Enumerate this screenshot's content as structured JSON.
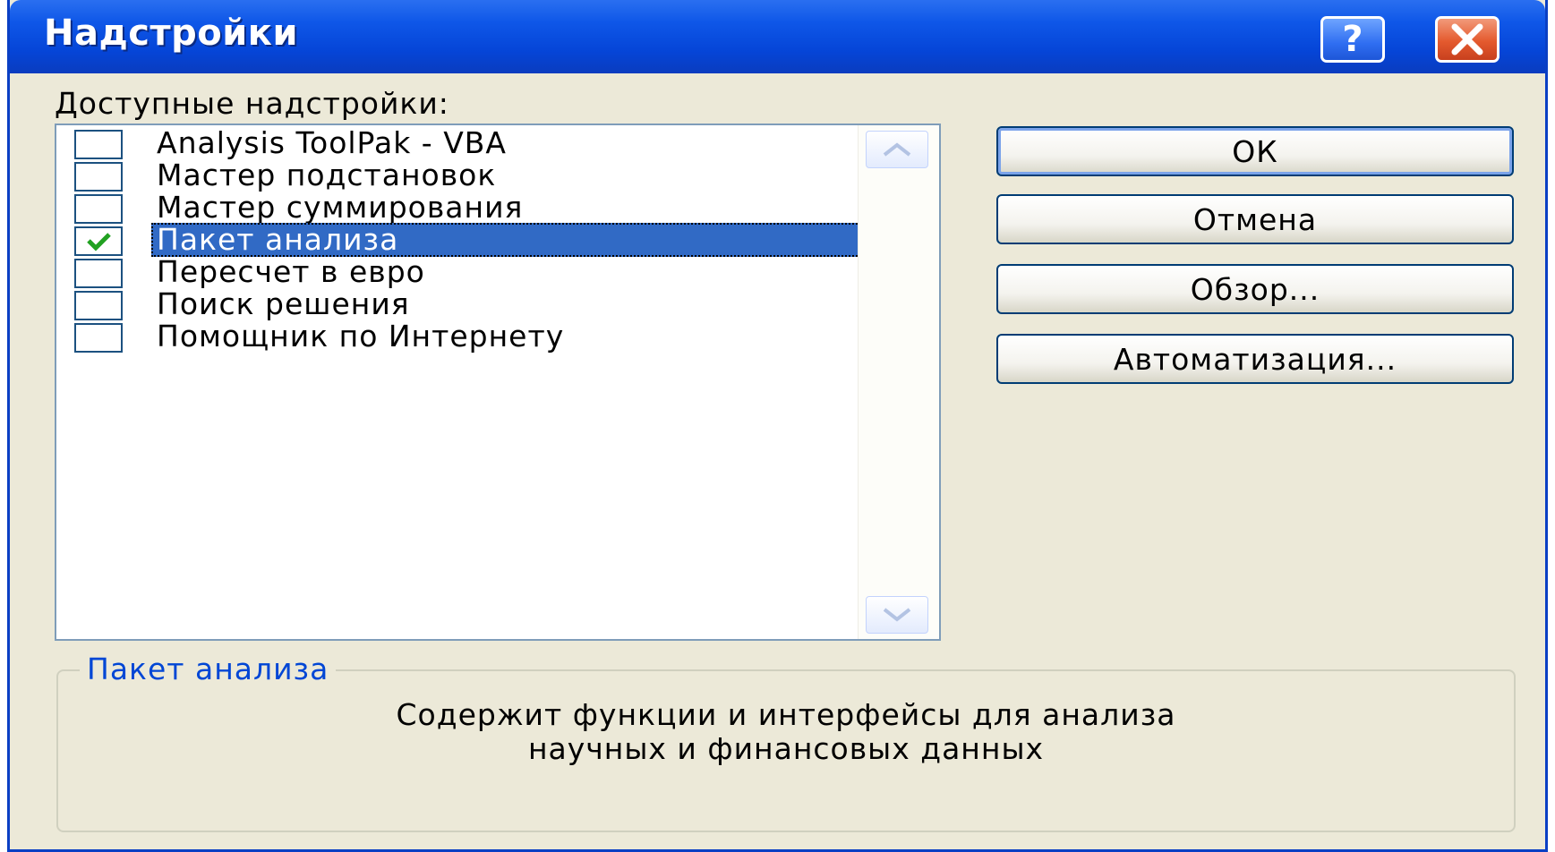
{
  "window": {
    "title": "Надстройки",
    "help_glyph": "?",
    "close_icon": "close-icon"
  },
  "addins": {
    "label": "Доступные надстройки:",
    "items": [
      {
        "label": "Analysis ToolPak - VBA",
        "checked": false
      },
      {
        "label": "Мастер подстановок",
        "checked": false
      },
      {
        "label": "Мастер суммирования",
        "checked": false
      },
      {
        "label": "Пакет анализа",
        "checked": true,
        "selected": true
      },
      {
        "label": "Пересчет в евро",
        "checked": false
      },
      {
        "label": "Поиск решения",
        "checked": false
      },
      {
        "label": "Помощник по Интернету",
        "checked": false
      }
    ]
  },
  "buttons": {
    "ok": "ОК",
    "cancel": "Отмена",
    "browse": "Обзор...",
    "automation": "Автоматизация..."
  },
  "description": {
    "title": "Пакет анализа",
    "line1": "Содержит функции и интерфейсы для анализа",
    "line2": "научных и финансовых данных"
  },
  "colors": {
    "titlebar": "#0545d7",
    "selection": "#316ac5",
    "dialog_bg": "#ece9d8",
    "check": "#21a121"
  }
}
